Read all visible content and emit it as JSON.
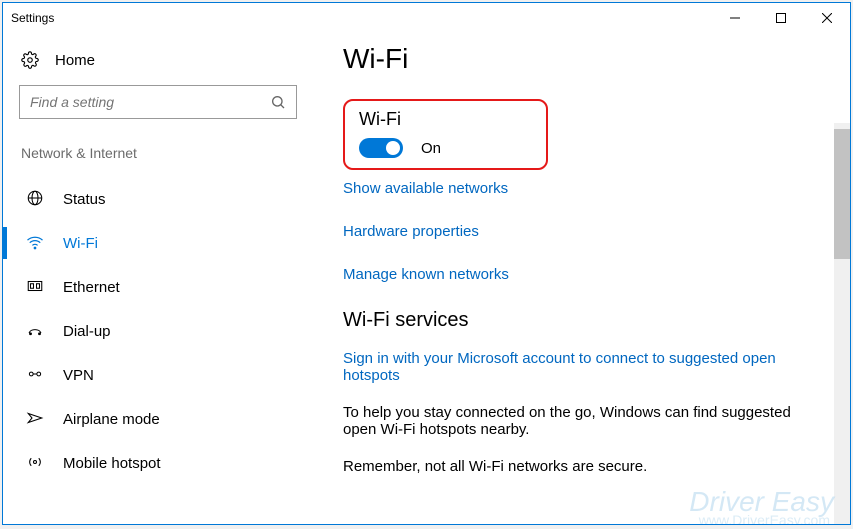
{
  "window": {
    "title": "Settings"
  },
  "sidebar": {
    "home": "Home",
    "search_placeholder": "Find a setting",
    "section": "Network & Internet",
    "items": [
      {
        "label": "Status"
      },
      {
        "label": "Wi-Fi"
      },
      {
        "label": "Ethernet"
      },
      {
        "label": "Dial-up"
      },
      {
        "label": "VPN"
      },
      {
        "label": "Airplane mode"
      },
      {
        "label": "Mobile hotspot"
      }
    ],
    "active_index": 1
  },
  "main": {
    "page_title": "Wi-Fi",
    "wifi": {
      "heading": "Wi-Fi",
      "toggle_state": "On"
    },
    "links": {
      "show_available": "Show available networks",
      "hardware_props": "Hardware properties",
      "manage_known": "Manage known networks"
    },
    "services": {
      "heading": "Wi-Fi services",
      "signin_link": "Sign in with your Microsoft account to connect to suggested open hotspots",
      "p1": "To help you stay connected on the go, Windows can find suggested open Wi-Fi hotspots nearby.",
      "p2": "Remember, not all Wi-Fi networks are secure."
    }
  },
  "watermark": {
    "brand": "Driver Easy",
    "url": "www.DriverEasy.com"
  },
  "colors": {
    "accent": "#0078d7",
    "link": "#0067c0",
    "highlight": "#e51919"
  }
}
